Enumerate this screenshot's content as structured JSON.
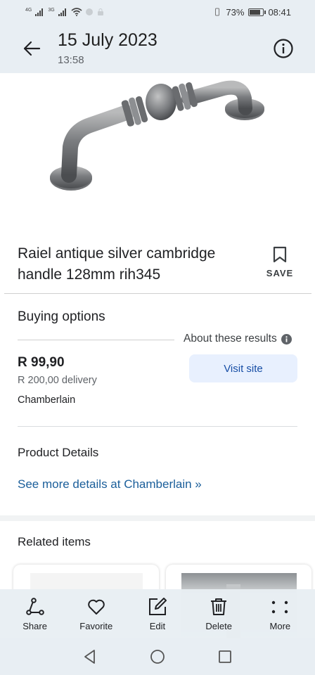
{
  "status_bar": {
    "network_left": "4G",
    "network_right": "3G",
    "battery_percent": "73%",
    "battery_level": 0.73,
    "time": "08:41"
  },
  "header": {
    "title": "15 July 2023",
    "subtitle": "13:58",
    "back_icon": "arrow-left-icon",
    "info_icon": "info-circle-icon"
  },
  "product": {
    "image_icon": "cabinet-handle-image",
    "title": "Raiel antique silver cambridge handle 128mm rih345",
    "save_label": "SAVE"
  },
  "buying_options": {
    "heading": "Buying options",
    "about_results": "About these results",
    "offer": {
      "price": "R 99,90",
      "delivery": "R 200,00 delivery",
      "seller": "Chamberlain",
      "visit_label": "Visit site"
    }
  },
  "product_details": {
    "heading": "Product Details",
    "link": "See more details at Chamberlain »"
  },
  "related": {
    "heading": "Related items"
  },
  "actions": [
    {
      "label": "Share",
      "icon": "share-icon"
    },
    {
      "label": "Favorite",
      "icon": "heart-icon"
    },
    {
      "label": "Edit",
      "icon": "edit-icon"
    },
    {
      "label": "Delete",
      "icon": "trash-icon"
    },
    {
      "label": "More",
      "icon": "more-dots-icon"
    }
  ],
  "colors": {
    "header_bg": "#e8eef3",
    "link": "#1a5e9a",
    "visit_button_bg": "#e8f0fe"
  }
}
